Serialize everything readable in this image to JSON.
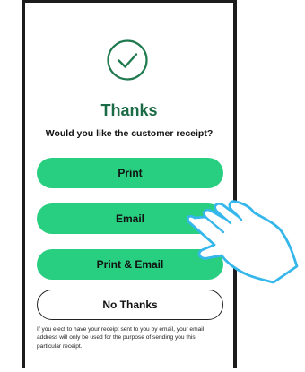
{
  "confirmation": {
    "title": "Thanks",
    "question": "Would you like the customer receipt?"
  },
  "buttons": {
    "print": "Print",
    "email": "Email",
    "print_email": "Print & Email",
    "no_thanks": "No Thanks"
  },
  "disclaimer": "If you elect to have your receipt sent to you by email, your email address will only be used for the purpose of sending you this particular receipt.",
  "icons": {
    "success": "check-circle-icon",
    "pointer": "hand-pointer-icon"
  },
  "colors": {
    "accent": "#28cf80",
    "check": "#1f7a4f",
    "title": "#1b6b46",
    "pointer": "#35b7ec"
  }
}
